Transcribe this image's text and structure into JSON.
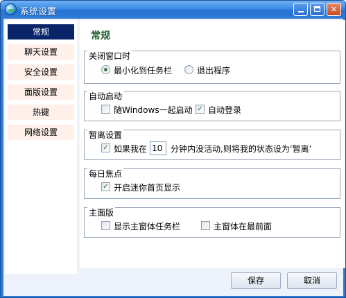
{
  "window": {
    "title": "系统设置"
  },
  "sidebar": {
    "items": [
      {
        "label": "常规"
      },
      {
        "label": "聊天设置"
      },
      {
        "label": "安全设置"
      },
      {
        "label": "面版设置"
      },
      {
        "label": "热键"
      },
      {
        "label": "网络设置"
      }
    ]
  },
  "main": {
    "title": "常规",
    "close_window": {
      "label": "关闭窗口时",
      "minimize_label": "最小化到任务栏",
      "exit_label": "退出程序"
    },
    "auto_start": {
      "label": "自动启动",
      "with_windows_label": "随Windows一起启动",
      "auto_login_label": "自动登录"
    },
    "away": {
      "label": "暂离设置",
      "prefix": "如果我在",
      "minutes": "10",
      "suffix": "分钟内没活动,则将我的状态设为‘暂离’"
    },
    "daily_focus": {
      "label": "每日焦点",
      "mini_home_label": "开启迷你首页显示"
    },
    "main_panel": {
      "label": "主面版",
      "show_taskbar_label": "显示主窗体任务栏",
      "always_top_label": "主窗体在最前面"
    }
  },
  "footer": {
    "save": "保存",
    "cancel": "取消"
  }
}
